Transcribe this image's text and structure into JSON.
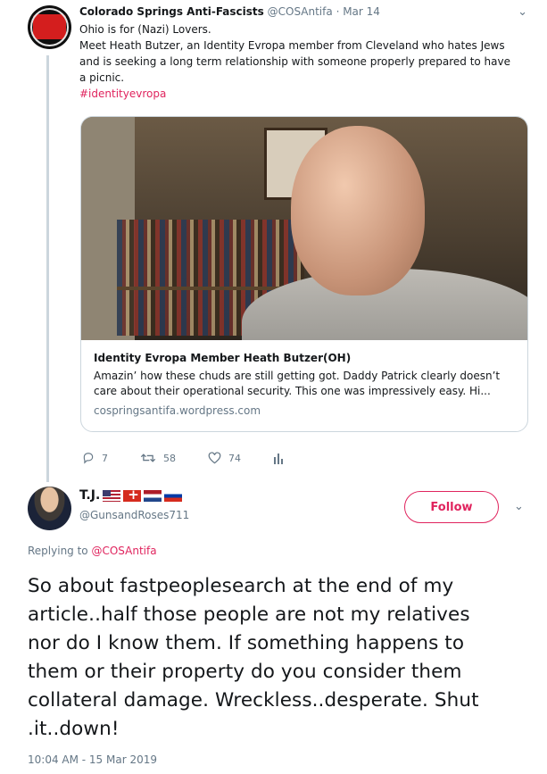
{
  "quoted_tweet": {
    "display_name": "Colorado Springs Anti-Fascists",
    "handle": "@COSAntifa",
    "date": "Mar 14",
    "lines": [
      "Ohio is for (Nazi) Lovers.",
      "Meet Heath Butzer, an Identity Evropa member from Cleveland who hates Jews",
      "and is seeking a long term relationship with someone properly prepared to have",
      "a picnic."
    ],
    "hashtag": "#identityevropa",
    "card": {
      "title": "Identity Evropa Member Heath Butzer(OH)",
      "desc_line1": "Amazin’ how these chuds are still getting got. Daddy Patrick clearly doesn’t",
      "desc_line2": "care about their operational security. This one was impressively easy. Hi...",
      "url": "cospringsantifa.wordpress.com"
    },
    "actions": {
      "replies": "7",
      "retweets": "58",
      "likes": "74"
    }
  },
  "reply_tweet": {
    "display_name": "T.J.",
    "handle": "@GunsandRoses711",
    "follow_label": "Follow",
    "replying_prefix": "Replying to",
    "replying_to": "@COSAntifa",
    "lines": [
      "So about fastpeoplesearch at the end of my",
      "article..half those people are not my relatives",
      "nor do I know them. If something happens to",
      "them or their property do you consider them",
      "collateral damage. Wreckless..desperate. Shut",
      ".it..down!"
    ],
    "timestamp": "10:04 AM - 15 Mar 2019"
  },
  "colors": {
    "accent": "#e0245e",
    "muted": "#657786",
    "border": "#ccd6dd"
  }
}
